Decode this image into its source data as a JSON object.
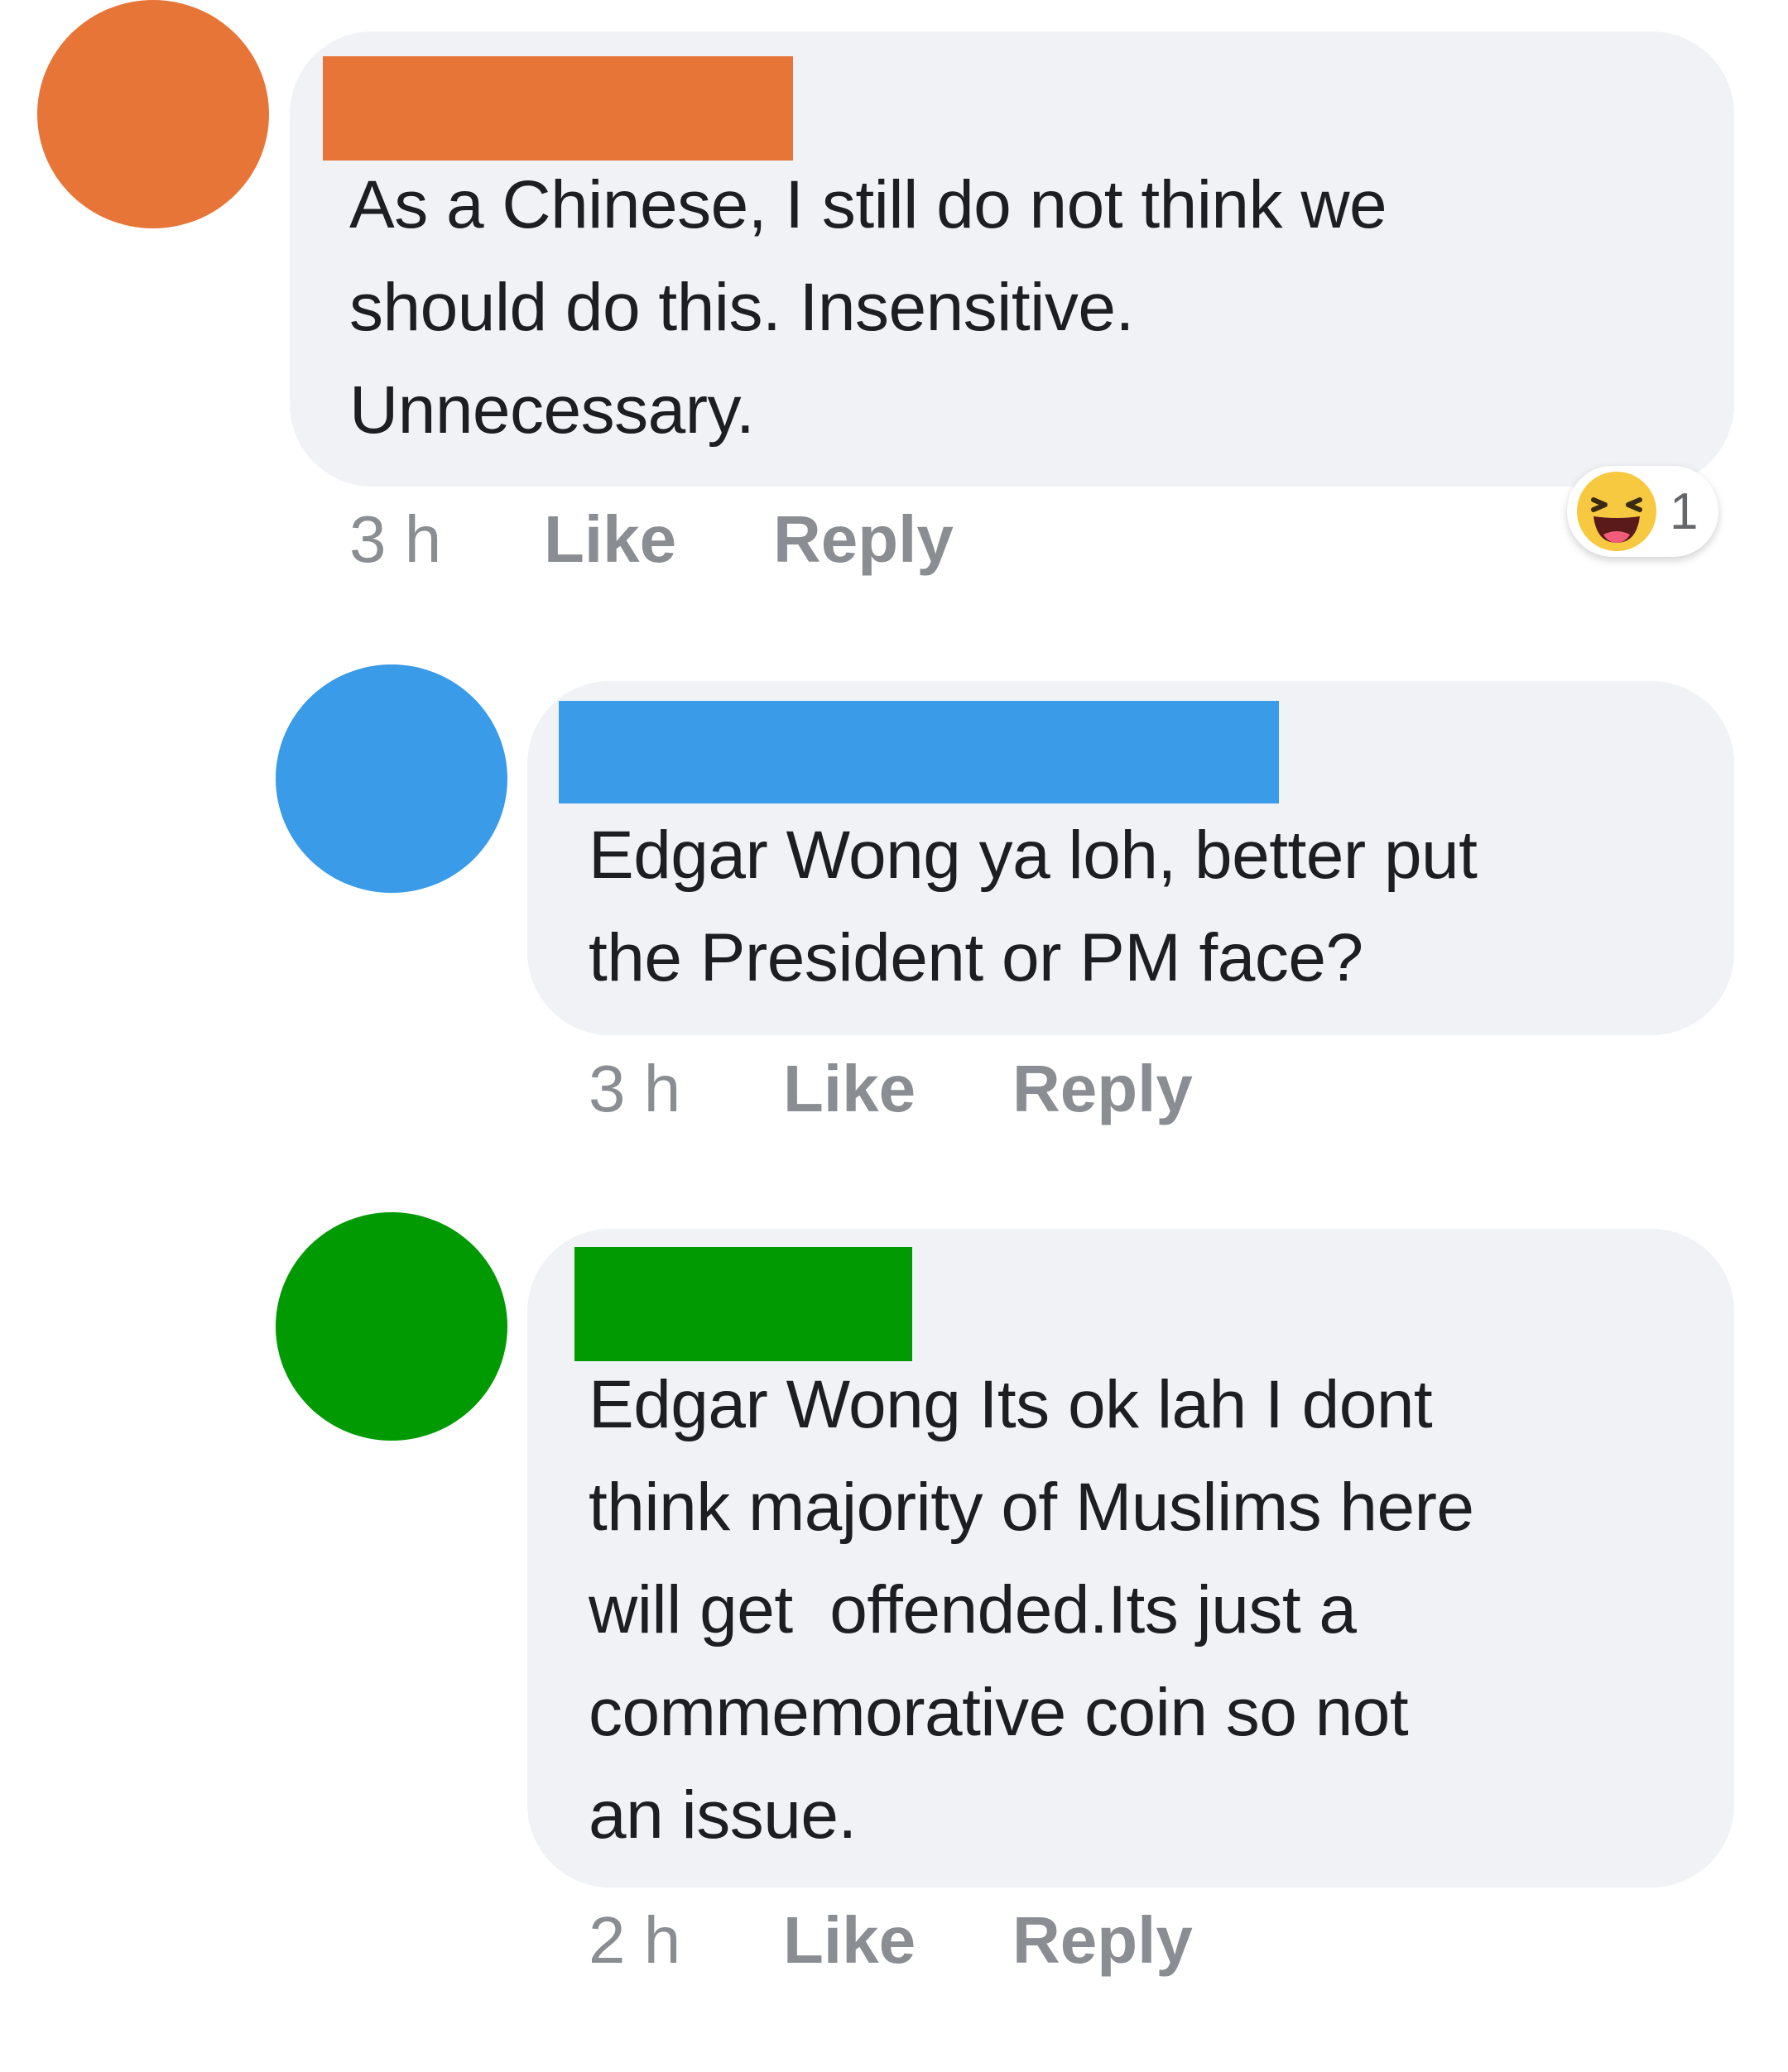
{
  "comments": [
    {
      "avatar_color": "#e87538",
      "name_redaction_color": "#e87538",
      "text": "As a Chinese, I still do not think we\nshould do this. Insensitive.\nUnnecessary.",
      "time": "3 h",
      "like_label": "Like",
      "reply_label": "Reply",
      "reaction": {
        "icon": "haha-emoji-icon",
        "count": "1"
      }
    },
    {
      "avatar_color": "#3a9be8",
      "name_redaction_color": "#3a9be8",
      "text": "Edgar Wong ya loh, better put\nthe President or PM face?",
      "time": "3 h",
      "like_label": "Like",
      "reply_label": "Reply"
    },
    {
      "avatar_color": "#029a03",
      "name_redaction_color": "#029a03",
      "text": "Edgar Wong Its ok lah I dont\nthink majority of Muslims here\nwill get  offended.Its just a\ncommemorative coin so not\nan issue.",
      "time": "2 h",
      "like_label": "Like",
      "reply_label": "Reply"
    }
  ]
}
